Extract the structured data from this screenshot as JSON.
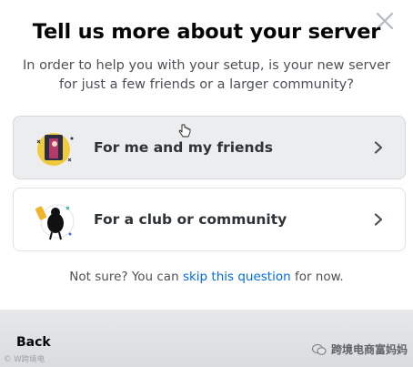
{
  "modal": {
    "title": "Tell us more about your server",
    "subtitle": "In order to help you with your setup, is your new server for just a few friends or a larger community?",
    "close_icon": "close-icon",
    "options": [
      {
        "label": "For me and my friends",
        "icon": "friends-illustration-icon",
        "hovered": true
      },
      {
        "label": "For a club or community",
        "icon": "community-illustration-icon",
        "hovered": false
      }
    ],
    "hint": {
      "prefix": "Not sure? You can ",
      "link": "skip this question",
      "suffix": " for now."
    }
  },
  "footer": {
    "back_label": "Back",
    "watermark_left": "© W跨境电",
    "watermark_right": "跨境电商富妈妈"
  },
  "colors": {
    "link": "#006ce7",
    "hover_bg": "#ebedef",
    "footer_bg": "#e3e5e8"
  }
}
